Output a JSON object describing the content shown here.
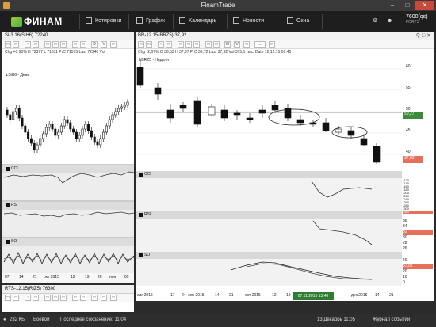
{
  "window": {
    "title": "FinamTrade"
  },
  "toolbar": {
    "brand": "ФИНАМ",
    "items": [
      {
        "label": "Котировки",
        "icon": "quotes-icon"
      },
      {
        "label": "График",
        "icon": "chart-icon"
      },
      {
        "label": "Календарь",
        "icon": "calendar-icon"
      },
      {
        "label": "Новости",
        "icon": "news-icon"
      },
      {
        "label": "Окна",
        "icon": "windows-icon"
      }
    ],
    "account_id": "7600(qs)",
    "account_type": "FORTS"
  },
  "left_panel": {
    "header": "Si-3.16(SiH6) 72240",
    "info": "Chg +0.93%   H 72377   L 71611   PrC 71575   Last 72240   Vol",
    "chart_label": "SiH6 - День",
    "cci_label": "CCI",
    "rsi_label": "RSI",
    "so_label": "SO",
    "x_ticks": [
      "07",
      "14",
      "21",
      "окт 2015",
      "12",
      "19",
      "26",
      "ноя",
      "09"
    ]
  },
  "left_bottom_panel": {
    "header": "RTS-12.15(RIZ5) 76300"
  },
  "right_panel": {
    "header": "BR-12.15(BRZ5) 37,92",
    "info": "Chg -2,67%   O 38,63   H 37,37   PrC 38,72   Last 37,92   Vol 375,1 тыс.   Date 12.12.15 01:45",
    "chart_label": "BRZ5 - Неделя",
    "cci_label": "CCI",
    "rsi_label": "RSI",
    "so_label": "SO",
    "price_axis": [
      "60",
      "55",
      "50",
      "45",
      "40"
    ],
    "last_price": "50,27",
    "current_price": "37,92",
    "cci_axis": [
      "-120",
      "-140",
      "-160",
      "-180",
      "-200",
      "-220",
      "-240",
      "-260",
      "-280",
      "-300"
    ],
    "cci_value": "-380",
    "rsi_axis": [
      "36",
      "34",
      "32",
      "30",
      "28",
      "26"
    ],
    "rsi_value": "32",
    "so_axis": [
      "40",
      "30",
      "20",
      "10",
      "0"
    ],
    "so_value": "37,92",
    "x_ticks": [
      "авг 2015",
      "17",
      "24",
      "сен 2015",
      "14",
      "21",
      "окт 2015",
      "12",
      "19",
      "дек 2015",
      "14",
      "21"
    ],
    "cursor_date": "07.11.2015 13:48"
  },
  "status": {
    "connection": "232 КБ",
    "mode": "Боевой",
    "saved": "Последнее сохранение: 11:04",
    "datetime": "13 Декабрь 11:05",
    "journal": "Журнал событий"
  }
}
